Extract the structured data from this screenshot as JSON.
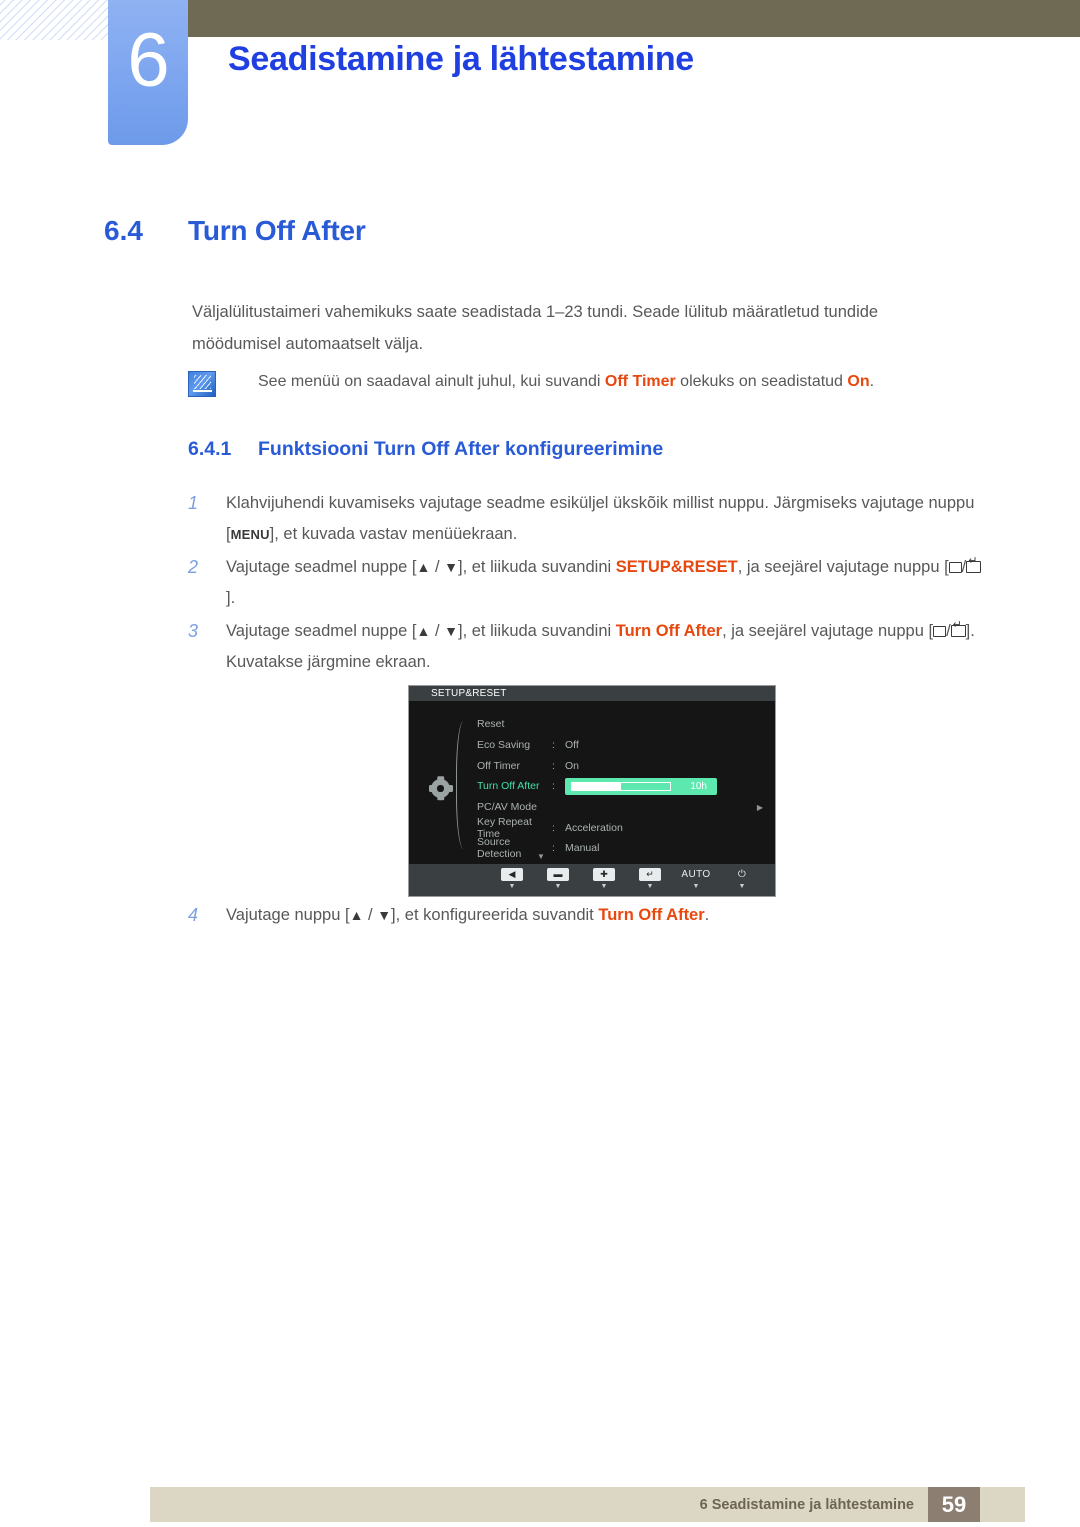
{
  "header": {
    "chapter_number": "6",
    "chapter_title": "Seadistamine ja lähtestamine"
  },
  "section": {
    "number": "6.4",
    "title": "Turn Off After"
  },
  "intro": "Väljalülitustaimeri vahemikuks saate seadistada 1–23 tundi. Seade lülitub määratletud tundide möödumisel automaatselt välja.",
  "note": {
    "text_before": "See menüü on saadaval ainult juhul, kui suvandi ",
    "hl1": "Off Timer",
    "text_mid": " olekuks on seadistatud ",
    "hl2": "On",
    "text_after": "."
  },
  "subsection": {
    "number": "6.4.1",
    "title": "Funktsiooni Turn Off After konfigureerimine"
  },
  "steps": [
    {
      "num": "1",
      "parts": [
        {
          "t": "text",
          "v": "Klahvijuhendi kuvamiseks vajutage seadme esiküljel ükskõik millist nuppu. Järgmiseks vajutage nuppu ["
        },
        {
          "t": "key",
          "v": "MENU"
        },
        {
          "t": "text",
          "v": "], et kuvada vastav menüüekraan."
        }
      ]
    },
    {
      "num": "2",
      "parts": [
        {
          "t": "text",
          "v": "Vajutage seadmel nuppe ["
        },
        {
          "t": "glyph",
          "v": "▲"
        },
        {
          "t": "text",
          "v": " / "
        },
        {
          "t": "glyph",
          "v": "▼"
        },
        {
          "t": "text",
          "v": "], et liikuda suvandini "
        },
        {
          "t": "hl",
          "v": "SETUP&RESET"
        },
        {
          "t": "text",
          "v": ", ja seejärel vajutage nuppu ["
        },
        {
          "t": "boxglyph",
          "v": ""
        },
        {
          "t": "text",
          "v": "/"
        },
        {
          "t": "entryglyph",
          "v": ""
        },
        {
          "t": "text",
          "v": "]."
        }
      ]
    },
    {
      "num": "3",
      "parts": [
        {
          "t": "text",
          "v": "Vajutage seadmel nuppe ["
        },
        {
          "t": "glyph",
          "v": "▲"
        },
        {
          "t": "text",
          "v": " / "
        },
        {
          "t": "glyph",
          "v": "▼"
        },
        {
          "t": "text",
          "v": "], et liikuda suvandini "
        },
        {
          "t": "hl",
          "v": "Turn Off After"
        },
        {
          "t": "text",
          "v": ", ja seejärel vajutage nuppu ["
        },
        {
          "t": "boxglyph",
          "v": ""
        },
        {
          "t": "text",
          "v": "/"
        },
        {
          "t": "entryglyph",
          "v": ""
        },
        {
          "t": "text",
          "v": "]. Kuvatakse järgmine ekraan."
        }
      ]
    },
    {
      "num": "4",
      "parts": [
        {
          "t": "text",
          "v": "Vajutage nuppu ["
        },
        {
          "t": "glyph",
          "v": "▲"
        },
        {
          "t": "text",
          "v": " / "
        },
        {
          "t": "glyph",
          "v": "▼"
        },
        {
          "t": "text",
          "v": "], et konfigureerida suvandit "
        },
        {
          "t": "hl",
          "v": "Turn Off After"
        },
        {
          "t": "text",
          "v": "."
        }
      ]
    }
  ],
  "osd": {
    "title": "SETUP&RESET",
    "rows": [
      {
        "label": "Reset",
        "colon": "",
        "value": "",
        "selected": false,
        "type": "plain"
      },
      {
        "label": "Eco Saving",
        "colon": ":",
        "value": "Off",
        "selected": false,
        "type": "plain"
      },
      {
        "label": "Off Timer",
        "colon": ":",
        "value": "On",
        "selected": false,
        "type": "plain"
      },
      {
        "label": "Turn Off After",
        "colon": ":",
        "value": "10h",
        "selected": true,
        "type": "slider",
        "fill_percent": 50
      },
      {
        "label": "PC/AV Mode",
        "colon": "",
        "value": "",
        "selected": false,
        "type": "submenu",
        "arrow": "▶"
      },
      {
        "label": "Key Repeat Time",
        "colon": ":",
        "value": "Acceleration",
        "selected": false,
        "type": "plain"
      },
      {
        "label": "Source Detection",
        "colon": ":",
        "value": "Manual",
        "selected": false,
        "type": "plain"
      }
    ],
    "scroll_caret": "▼",
    "buttons": [
      {
        "name": "back",
        "glyph": "◀",
        "caret": "▼",
        "plain": false
      },
      {
        "name": "minus",
        "glyph": "▬",
        "caret": "▼",
        "plain": false
      },
      {
        "name": "plus",
        "glyph": "✚",
        "caret": "▼",
        "plain": false
      },
      {
        "name": "enter",
        "glyph": "↵",
        "caret": "▼",
        "plain": false
      },
      {
        "name": "auto",
        "glyph": "AUTO",
        "caret": "▼",
        "plain": true
      },
      {
        "name": "power",
        "glyph": "⏻",
        "caret": "▼",
        "plain": true
      }
    ]
  },
  "footer": {
    "text": "6 Seadistamine ja lähtestamine",
    "page": "59"
  },
  "colors": {
    "accent_blue": "#2a5bd7",
    "title_blue": "#1f3fe0",
    "highlight_orange": "#e8470d",
    "olive": "#6e6a54",
    "tab_blue": "#7ba4ef",
    "osd_green": "#3fe0a8",
    "footer_bg": "#dcd7c5",
    "footer_page_bg": "#8c7f72"
  }
}
